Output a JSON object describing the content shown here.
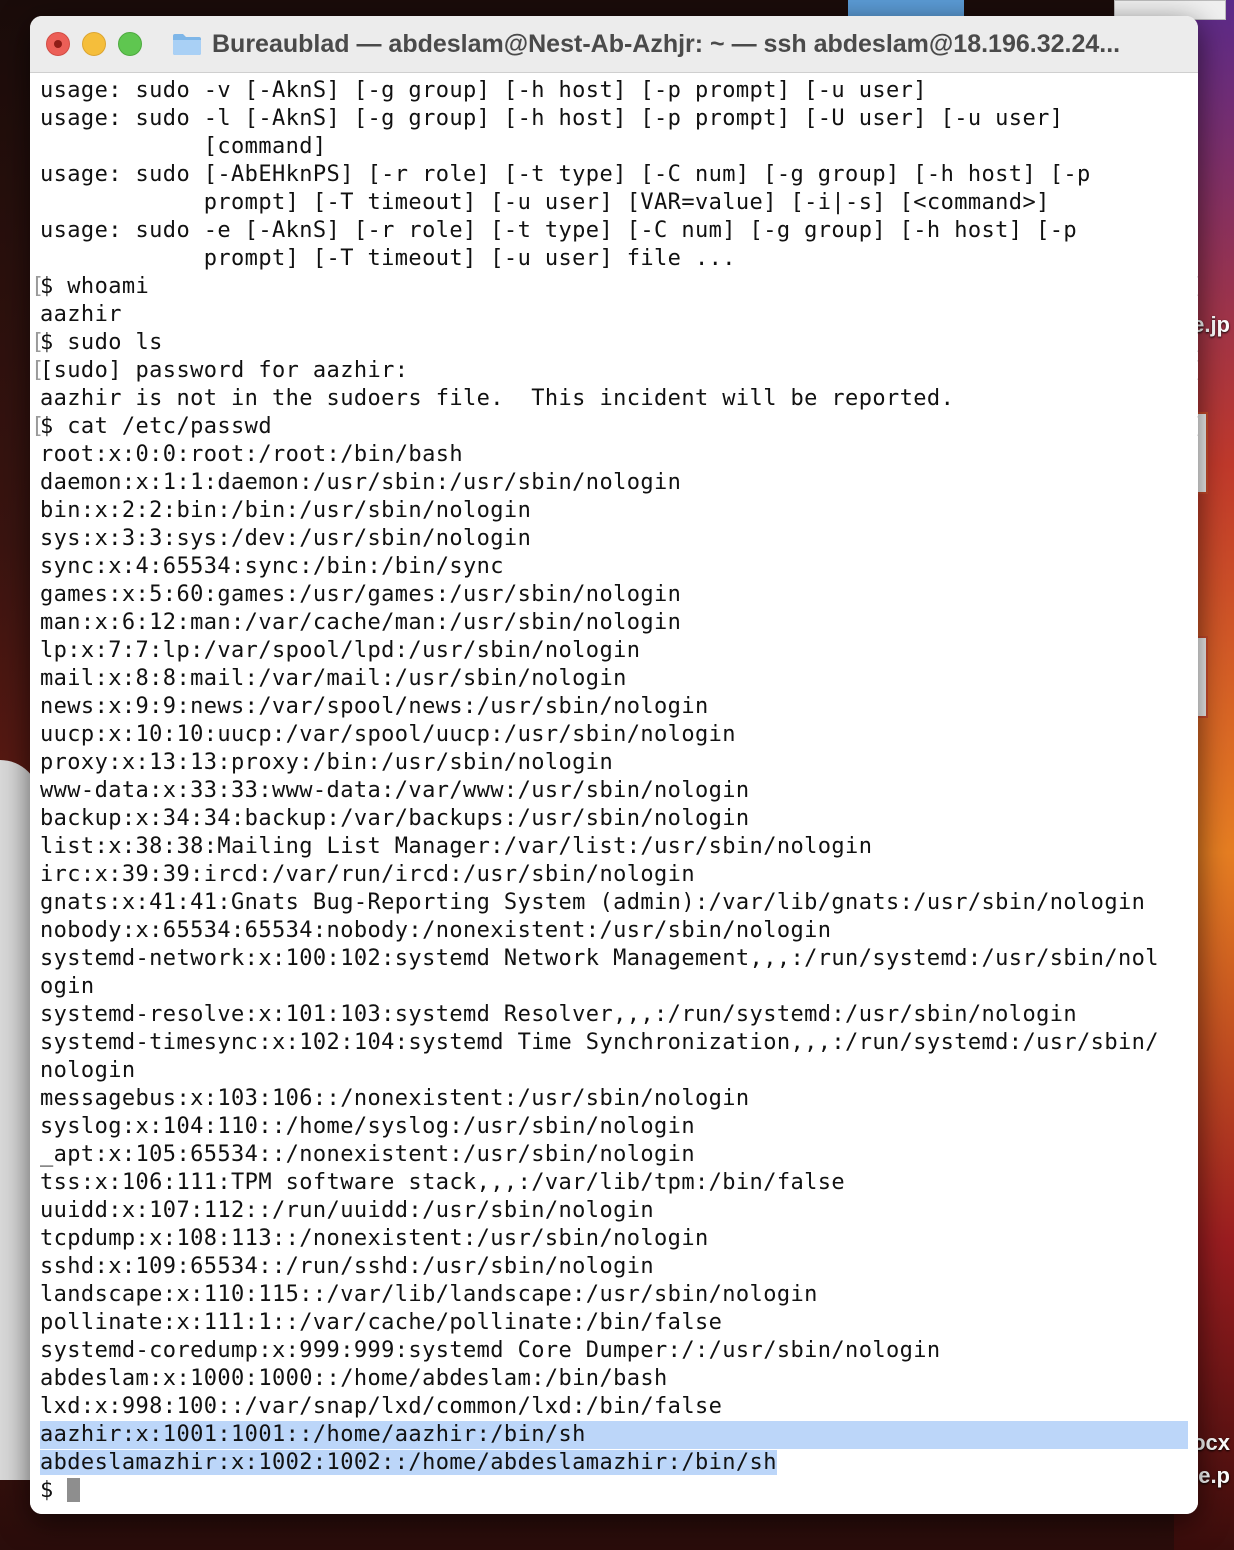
{
  "window": {
    "title": "Bureaublad — abdeslam@Nest-Ab-Azhjr: ~ — ssh abdeslam@18.196.32.24..."
  },
  "desktop": {
    "labels": [
      "e.jp",
      "locx",
      "e.p"
    ]
  },
  "terminal": {
    "lines": [
      "usage: sudo -v [-AknS] [-g group] [-h host] [-p prompt] [-u user]",
      "usage: sudo -l [-AknS] [-g group] [-h host] [-p prompt] [-U user] [-u user]",
      "            [command]",
      "usage: sudo [-AbEHknPS] [-r role] [-t type] [-C num] [-g group] [-h host] [-p",
      "            prompt] [-T timeout] [-u user] [VAR=value] [-i|-s] [<command>]",
      "usage: sudo -e [-AknS] [-r role] [-t type] [-C num] [-g group] [-h host] [-p",
      "            prompt] [-T timeout] [-u user] file ...",
      "$ whoami",
      "aazhir",
      "$ sudo ls",
      "[sudo] password for aazhir:",
      "aazhir is not in the sudoers file.  This incident will be reported.",
      "$ cat /etc/passwd",
      "root:x:0:0:root:/root:/bin/bash",
      "daemon:x:1:1:daemon:/usr/sbin:/usr/sbin/nologin",
      "bin:x:2:2:bin:/bin:/usr/sbin/nologin",
      "sys:x:3:3:sys:/dev:/usr/sbin/nologin",
      "sync:x:4:65534:sync:/bin:/bin/sync",
      "games:x:5:60:games:/usr/games:/usr/sbin/nologin",
      "man:x:6:12:man:/var/cache/man:/usr/sbin/nologin",
      "lp:x:7:7:lp:/var/spool/lpd:/usr/sbin/nologin",
      "mail:x:8:8:mail:/var/mail:/usr/sbin/nologin",
      "news:x:9:9:news:/var/spool/news:/usr/sbin/nologin",
      "uucp:x:10:10:uucp:/var/spool/uucp:/usr/sbin/nologin",
      "proxy:x:13:13:proxy:/bin:/usr/sbin/nologin",
      "www-data:x:33:33:www-data:/var/www:/usr/sbin/nologin",
      "backup:x:34:34:backup:/var/backups:/usr/sbin/nologin",
      "list:x:38:38:Mailing List Manager:/var/list:/usr/sbin/nologin",
      "irc:x:39:39:ircd:/var/run/ircd:/usr/sbin/nologin",
      "gnats:x:41:41:Gnats Bug-Reporting System (admin):/var/lib/gnats:/usr/sbin/nologin",
      "nobody:x:65534:65534:nobody:/nonexistent:/usr/sbin/nologin",
      "systemd-network:x:100:102:systemd Network Management,,,:/run/systemd:/usr/sbin/nol",
      "ogin",
      "systemd-resolve:x:101:103:systemd Resolver,,,:/run/systemd:/usr/sbin/nologin",
      "systemd-timesync:x:102:104:systemd Time Synchronization,,,:/run/systemd:/usr/sbin/",
      "nologin",
      "messagebus:x:103:106::/nonexistent:/usr/sbin/nologin",
      "syslog:x:104:110::/home/syslog:/usr/sbin/nologin",
      "_apt:x:105:65534::/nonexistent:/usr/sbin/nologin",
      "tss:x:106:111:TPM software stack,,,:/var/lib/tpm:/bin/false",
      "uuidd:x:107:112::/run/uuidd:/usr/sbin/nologin",
      "tcpdump:x:108:113::/nonexistent:/usr/sbin/nologin",
      "sshd:x:109:65534::/run/sshd:/usr/sbin/nologin",
      "landscape:x:110:115::/var/lib/landscape:/usr/sbin/nologin",
      "pollinate:x:111:1::/var/cache/pollinate:/bin/false",
      "systemd-coredump:x:999:999:systemd Core Dumper:/:/usr/sbin/nologin",
      "abdeslam:x:1000:1000::/home/abdeslam:/bin/bash",
      "lxd:x:998:100::/var/snap/lxd/common/lxd:/bin/false",
      "aazhir:x:1001:1001::/home/aazhir:/bin/sh",
      "abdeslamazhir:x:1002:1002::/home/abdeslamazhir:/bin/sh"
    ],
    "bracketed_rows": [
      7,
      9,
      10,
      12
    ],
    "highlighted_full_rows": [
      48
    ],
    "highlighted_text_rows": [
      49
    ],
    "prompt": "$ "
  },
  "colors": {
    "selection": "#bcd6f9",
    "close": "#ec5f57",
    "minimize": "#f5be3b",
    "maximize": "#5fc650"
  }
}
